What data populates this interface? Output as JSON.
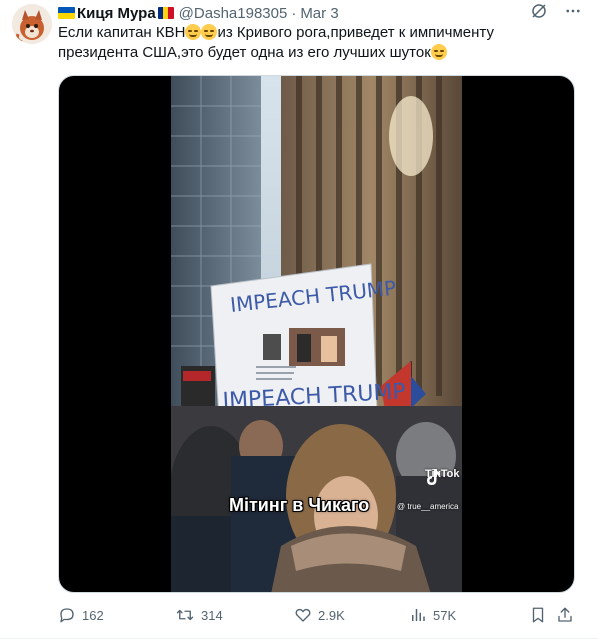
{
  "tweet": {
    "author_name": "Киця Мура",
    "author_handle": "@Dasha198305",
    "separator": "·",
    "date": "Mar 3",
    "text_part1": "Если капитан КВН",
    "text_part2": "из Кривого рога,приведет к импичменту президента США,это будет одна из его лучших шуток",
    "flag_left": "ukraine-flag",
    "flag_right": "romania-flag"
  },
  "media": {
    "sign_text_top": "IMPEACH TRUMP",
    "sign_text_bottom": "IMPEACH TRUMP",
    "caption": "Мітинг в Чикаго",
    "watermark_brand": "TikTok",
    "watermark_handle": "@ true__america"
  },
  "actions": {
    "replies": "162",
    "reposts": "314",
    "likes": "2.9K",
    "views": "57K"
  },
  "colors": {
    "text_primary": "#0f1419",
    "text_secondary": "#536471",
    "media_bg": "#000000",
    "ua_blue": "#0057b7",
    "ua_yellow": "#ffd700"
  }
}
